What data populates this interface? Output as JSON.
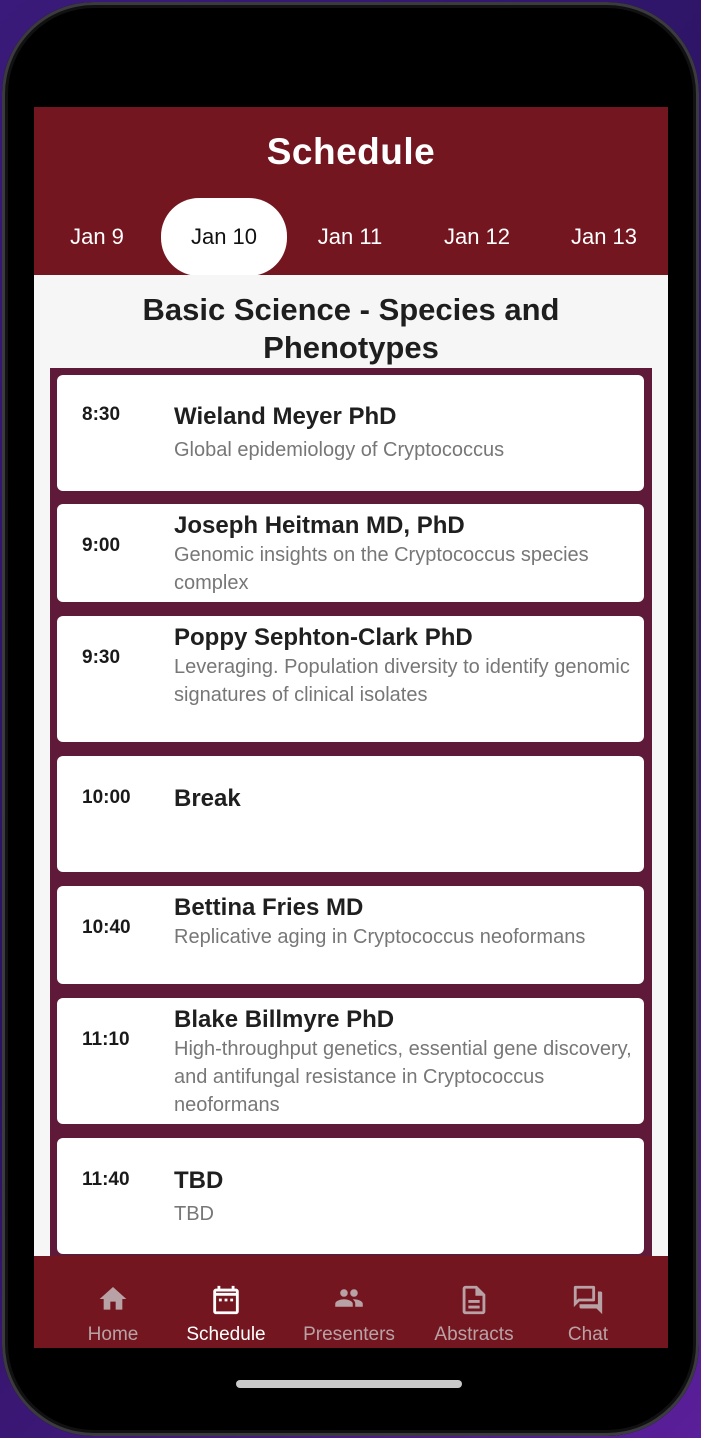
{
  "header": {
    "title": "Schedule"
  },
  "date_tabs": [
    {
      "label": "Jan 9",
      "active": false
    },
    {
      "label": "Jan 10",
      "active": true
    },
    {
      "label": "Jan 11",
      "active": false
    },
    {
      "label": "Jan 12",
      "active": false
    },
    {
      "label": "Jan 13",
      "active": false
    }
  ],
  "session": {
    "title": "Basic Science - Species and Phenotypes",
    "items": [
      {
        "time": "8:30",
        "speaker": "Wieland Meyer PhD",
        "talk": "Global epidemiology of Cryptococcus"
      },
      {
        "time": "9:00",
        "speaker": "Joseph Heitman MD, PhD",
        "talk": "Genomic insights on the Cryptococcus species complex"
      },
      {
        "time": "9:30",
        "speaker": "Poppy Sephton-Clark PhD",
        "talk": "Leveraging. Population diversity to identify genomic signatures of clinical isolates"
      },
      {
        "time": "10:00",
        "speaker": "Break",
        "talk": ""
      },
      {
        "time": "10:40",
        "speaker": "Bettina Fries MD",
        "talk": "Replicative aging in Cryptococcus neoformans"
      },
      {
        "time": "11:10",
        "speaker": "Blake Billmyre PhD",
        "talk": "High-throughput genetics, essential gene discovery, and antifungal resistance in Cryptococcus neoformans"
      },
      {
        "time": "11:40",
        "speaker": "TBD",
        "talk": "TBD"
      }
    ]
  },
  "bottom_nav": [
    {
      "label": "Home",
      "icon": "home-icon",
      "active": false
    },
    {
      "label": "Schedule",
      "icon": "calendar-icon",
      "active": true
    },
    {
      "label": "Presenters",
      "icon": "people-icon",
      "active": false
    },
    {
      "label": "Abstracts",
      "icon": "document-icon",
      "active": false
    },
    {
      "label": "Chat",
      "icon": "chat-icon",
      "active": false
    }
  ],
  "colors": {
    "brand": "#74161f",
    "frame": "#5f1a3a",
    "muted_text": "#777777"
  }
}
